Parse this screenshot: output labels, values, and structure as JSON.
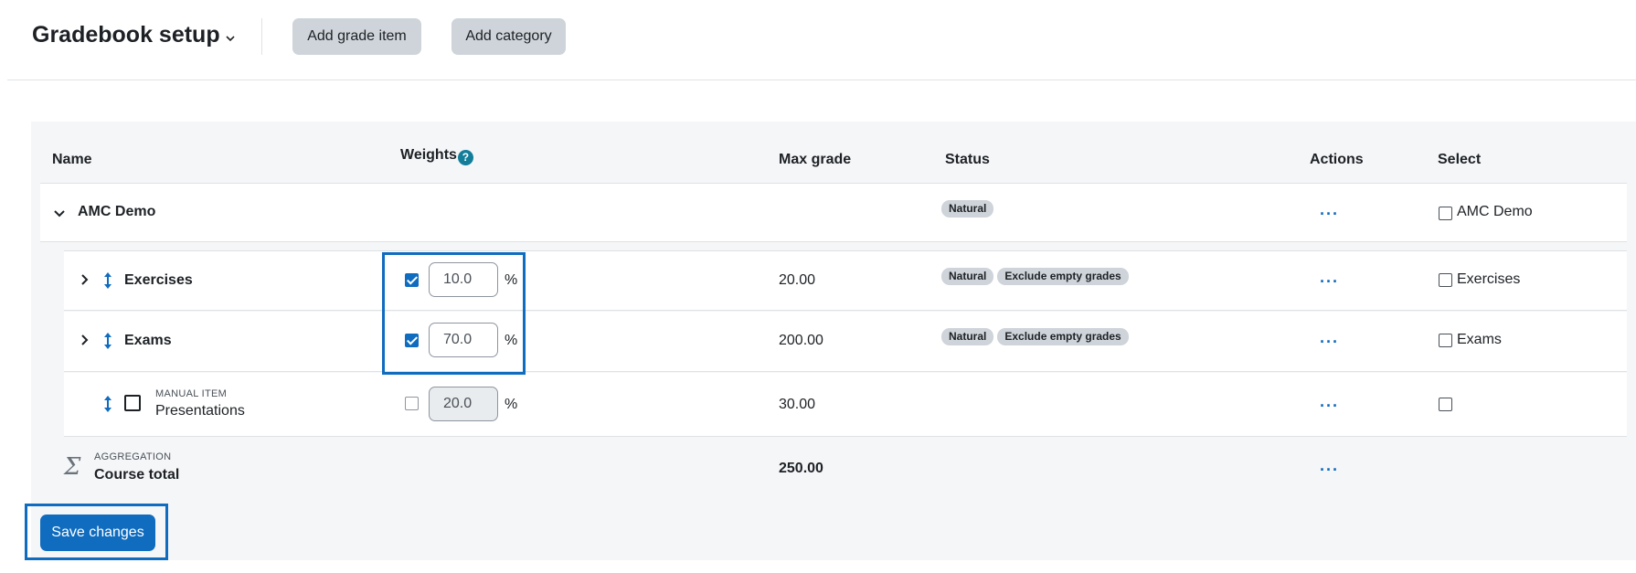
{
  "header": {
    "title": "Gradebook setup",
    "add_grade_item": "Add grade item",
    "add_category": "Add category"
  },
  "table": {
    "columns": {
      "name": "Name",
      "weights": "Weights",
      "weights_help": "?",
      "max_grade": "Max grade",
      "status": "Status",
      "actions": "Actions",
      "select": "Select"
    },
    "category": {
      "name": "AMC Demo",
      "status_badges": [
        "Natural"
      ],
      "actions": "···",
      "select_label": "AMC Demo"
    },
    "items": [
      {
        "name": "Exercises",
        "weight_checked": true,
        "weight_value": "10.0",
        "percent": "%",
        "max_grade": "20.00",
        "badge1": "Natural",
        "badge2": "Exclude empty grades",
        "actions": "···",
        "select_label": "Exercises"
      },
      {
        "name": "Exams",
        "weight_checked": true,
        "weight_value": "70.0",
        "percent": "%",
        "max_grade": "200.00",
        "badge1": "Natural",
        "badge2": "Exclude empty grades",
        "actions": "···",
        "select_label": "Exams"
      },
      {
        "type_label": "MANUAL ITEM",
        "name": "Presentations",
        "weight_checked": false,
        "weight_value": "20.0",
        "percent": "%",
        "max_grade": "30.00",
        "actions": "···"
      }
    ],
    "total": {
      "type_label": "AGGREGATION",
      "name": "Course total",
      "icon_glyph": "Σ",
      "max_grade": "250.00",
      "actions": "···"
    }
  },
  "footer": {
    "save_label": "Save changes"
  },
  "colors": {
    "primary": "#0f6cbf",
    "secondary_button": "#ced4da",
    "badge": "#ced4da",
    "table_bg": "#f5f6f8"
  }
}
